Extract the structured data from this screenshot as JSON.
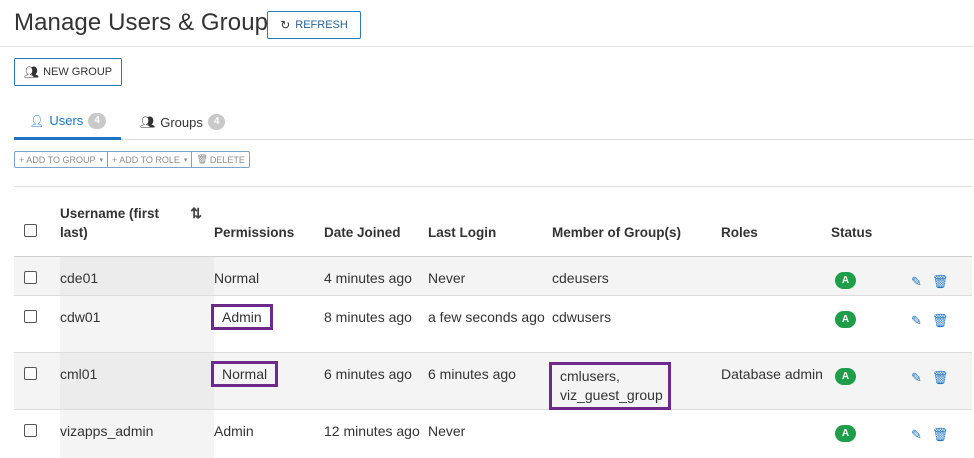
{
  "header": {
    "title": "Manage Users & Groups",
    "refresh_label": "REFRESH",
    "refresh_icon": "refresh-icon"
  },
  "toolbar": {
    "new_group_label": "NEW GROUP",
    "new_group_icon": "users-icon"
  },
  "tabs": [
    {
      "label": "Users",
      "count": "4",
      "icon": "user-icon",
      "active": true
    },
    {
      "label": "Groups",
      "count": "4",
      "icon": "users-icon",
      "active": false
    }
  ],
  "actions": [
    {
      "label": "ADD TO GROUP",
      "icon": "plus-icon",
      "dropdown": true
    },
    {
      "label": "ADD TO ROLE",
      "icon": "plus-icon",
      "dropdown": true
    },
    {
      "label": "DELETE",
      "icon": "trash-icon",
      "dropdown": false
    }
  ],
  "table": {
    "columns": [
      "Username (first last)",
      "Permissions",
      "Date Joined",
      "Last Login",
      "Member of Group(s)",
      "Roles",
      "Status"
    ],
    "rows": [
      {
        "username": "cde01",
        "permissions": "Normal",
        "date_joined": "4 minutes ago",
        "last_login": "Never",
        "groups": "cdeusers",
        "roles": "",
        "status": "A"
      },
      {
        "username": "cdw01",
        "permissions": "Admin",
        "date_joined": "8 minutes ago",
        "last_login": "a few seconds ago",
        "groups": "cdwusers",
        "roles": "",
        "status": "A"
      },
      {
        "username": "cml01",
        "permissions": "Normal",
        "date_joined": "6 minutes ago",
        "last_login": "6 minutes ago",
        "groups": "cmlusers, viz_guest_group",
        "roles": "Database admin",
        "status": "A"
      },
      {
        "username": "vizapps_admin",
        "permissions": "Admin",
        "date_joined": "12 minutes ago",
        "last_login": "Never",
        "groups": "",
        "roles": "",
        "status": "A"
      }
    ]
  },
  "colors": {
    "accent": "#1f74c1",
    "status_active": "#1e9e4a",
    "highlight": "#6d2a8c"
  }
}
